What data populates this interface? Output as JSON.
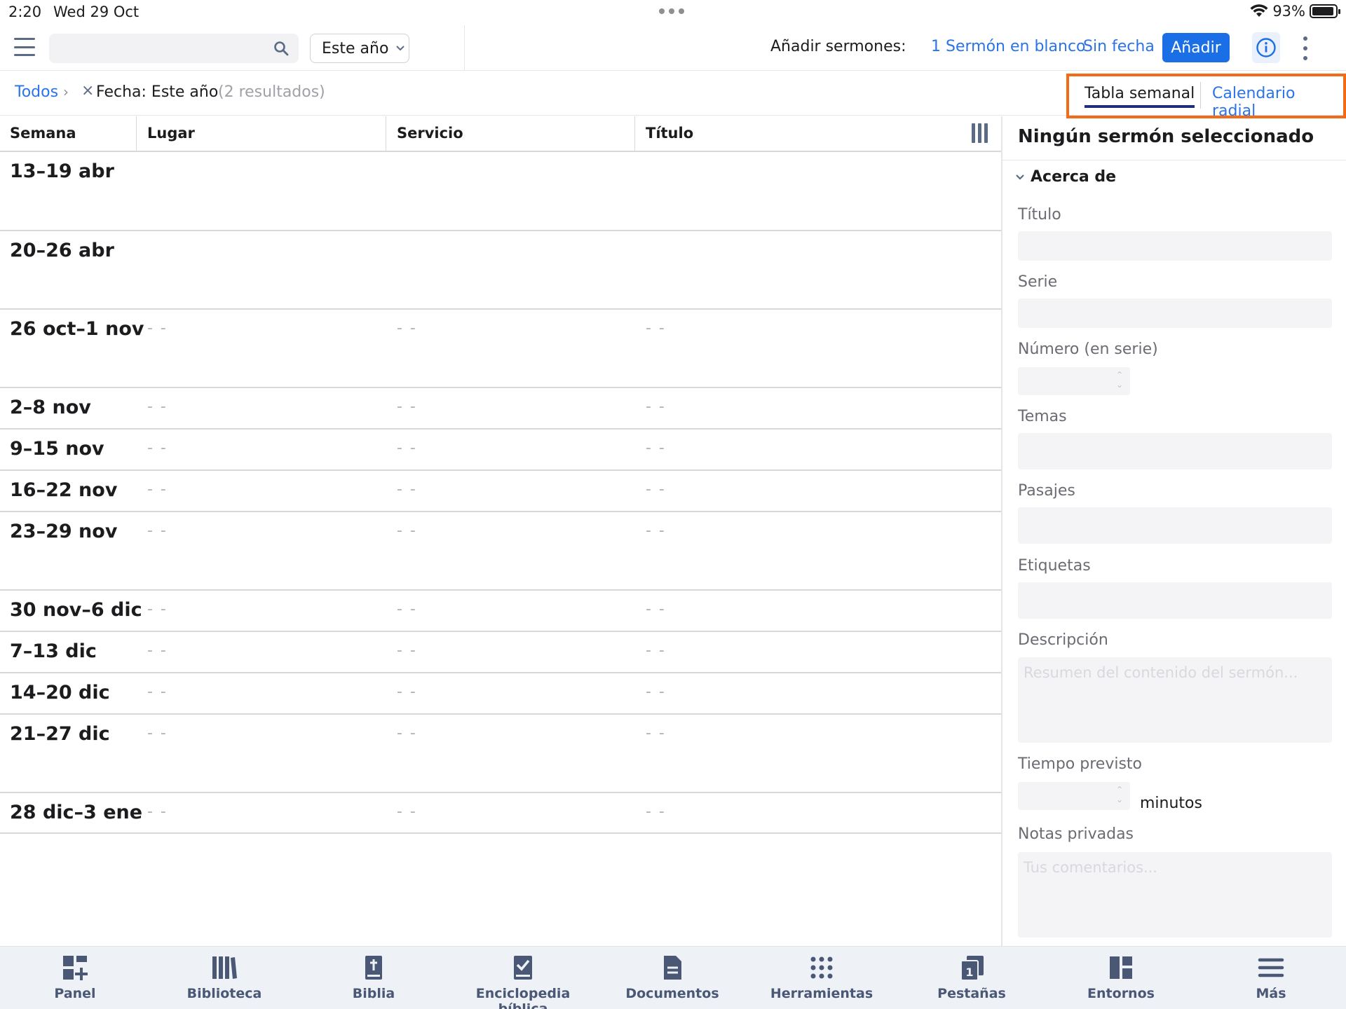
{
  "status": {
    "time": "2:20",
    "date": "Wed 29 Oct",
    "battery": "93%",
    "battery_level": 0.93
  },
  "toolbar": {
    "search_placeholder": "",
    "year_filter": "Este año",
    "add_label": "Añadir sermones:",
    "add_count": "1",
    "add_blank": "Sermón en blanco",
    "add_nodate": "Sin fecha",
    "add_button": "Añadir"
  },
  "filter": {
    "all": "Todos",
    "chevron": "›",
    "remove": "×",
    "active": "Fecha: Este año",
    "results": "(2 resultados)",
    "view_week": "Tabla semanal",
    "view_radial": "Calendario radial"
  },
  "table": {
    "columns": [
      "Semana",
      "Lugar",
      "Servicio",
      "Título"
    ],
    "rows": [
      {
        "week": "13–19 abr",
        "place": "",
        "service": "",
        "title": ""
      },
      {
        "week": "20–26 abr",
        "place": "",
        "service": "",
        "title": ""
      },
      {
        "week": "26 oct–1 nov",
        "place": "- -",
        "service": "- -",
        "title": "- -"
      },
      {
        "week": "2–8 nov",
        "place": "- -",
        "service": "- -",
        "title": "- -"
      },
      {
        "week": "9–15 nov",
        "place": "- -",
        "service": "- -",
        "title": "- -"
      },
      {
        "week": "16–22 nov",
        "place": "- -",
        "service": "- -",
        "title": "- -"
      },
      {
        "week": "23–29 nov",
        "place": "- -",
        "service": "- -",
        "title": "- -"
      },
      {
        "week": "30 nov–6 dic",
        "place": "- -",
        "service": "- -",
        "title": "- -"
      },
      {
        "week": "7–13 dic",
        "place": "- -",
        "service": "- -",
        "title": "- -"
      },
      {
        "week": "14–20 dic",
        "place": "- -",
        "service": "- -",
        "title": "- -"
      },
      {
        "week": "21–27 dic",
        "place": "- -",
        "service": "- -",
        "title": "- -"
      },
      {
        "week": "28 dic–3 ene",
        "place": "- -",
        "service": "- -",
        "title": "- -"
      }
    ]
  },
  "panel": {
    "title": "Ningún sermón seleccionado",
    "section": "Acerca de",
    "fields": {
      "titulo": "Título",
      "serie": "Serie",
      "numero": "Número (en serie)",
      "temas": "Temas",
      "pasajes": "Pasajes",
      "etiquetas": "Etiquetas",
      "descripcion": "Descripción",
      "descripcion_placeholder": "Resumen del contenido del sermón...",
      "tiempo": "Tiempo previsto",
      "minutos": "minutos",
      "notas": "Notas privadas",
      "notas_placeholder": "Tus comentarios..."
    }
  },
  "tabbar": [
    "Panel",
    "Biblioteca",
    "Biblia",
    "Enciclopedia bíblica",
    "Documentos",
    "Herramientas",
    "Pestañas",
    "Entornos",
    "Más"
  ],
  "colors": {
    "accent": "#1a6fe6",
    "link": "#2a73e8",
    "highlight": "#f36b16",
    "icon": "#4a5875"
  }
}
